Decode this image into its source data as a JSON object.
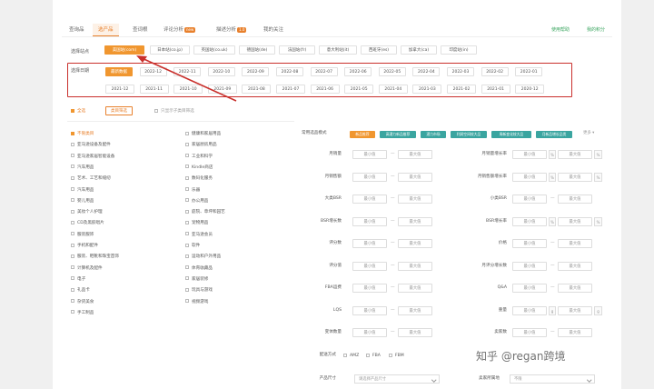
{
  "tabs": [
    {
      "label": "查询品"
    },
    {
      "label": "选产品",
      "active": true
    },
    {
      "label": "查词根"
    },
    {
      "label": "评论分析",
      "badge": "new"
    },
    {
      "label": "描述分析",
      "badge": "1.0"
    },
    {
      "label": "我的关注"
    }
  ],
  "top_links": [
    "使用帮助",
    "我的积分"
  ],
  "site": {
    "label": "选择站点",
    "options": [
      {
        "label": "美国站(com)",
        "active": true
      },
      {
        "label": "日本站(co.jp)"
      },
      {
        "label": "英国站(co.uk)"
      },
      {
        "label": "德国站(de)"
      },
      {
        "label": "法国站(fr)"
      },
      {
        "label": "意大利站(it)"
      },
      {
        "label": "西班牙(es)"
      },
      {
        "label": "加拿大(ca)"
      },
      {
        "label": "印度站(in)"
      }
    ]
  },
  "time": {
    "label": "选择日期",
    "row1": [
      "最新数据",
      "2022-12",
      "2022-11",
      "2022-10",
      "2022-09",
      "2022-08",
      "2022-07",
      "2022-06",
      "2022-05",
      "2022-04",
      "2022-03",
      "2022-02",
      "2022-01"
    ],
    "row2": [
      "2021-12",
      "2021-11",
      "2021-10",
      "2021-09",
      "2021-08",
      "2021-07",
      "2021-06",
      "2021-05",
      "2021-04",
      "2021-03",
      "2021-02",
      "2021-01",
      "2020-12"
    ]
  },
  "category_header": {
    "all": "全选",
    "btn": "类目筛选",
    "check": "只显示子类目筛选"
  },
  "categories_left": [
    "不限类目",
    "亚马逊设备及配件",
    "亚马逊家居智能设备",
    "汽车用品",
    "艺术、工艺和缝纫",
    "汽车用品",
    "婴儿用品",
    "美妆个人护理",
    "CD及黑胶唱片",
    "服装服饰",
    "手机和配件",
    "服装、鞋靴和珠宝首饰",
    "计算机及配件",
    "电子",
    "礼品卡",
    "杂货美食",
    "手工制品"
  ],
  "categories_right": [
    "健康和家居用品",
    "家居厨房用品",
    "工业和科学",
    "Kindle商店",
    "数码化服务",
    "乐器",
    "办公用品",
    "庭院、草坪和园艺",
    "宠物用品",
    "亚马逊会员",
    "软件",
    "运动和户外用品",
    "体育收藏品",
    "家居装修",
    "玩具与游戏",
    "视频游戏"
  ],
  "quick": {
    "label": "常用选品模式",
    "more": "更多 ▾",
    "tags": [
      {
        "label": "新品推荐",
        "color": "#f0962f"
      },
      {
        "label": "高潜力新品推荐",
        "color": "#3aa5a0"
      },
      {
        "label": "潜力市场",
        "color": "#3aa5a0"
      },
      {
        "label": "利润空间较大品",
        "color": "#3aa5a0"
      },
      {
        "label": "周新变化较大品",
        "color": "#3aa5a0"
      },
      {
        "label": "月新品增长品类",
        "color": "#3aa5a0"
      }
    ]
  },
  "filters_left": [
    {
      "label": "月销量",
      "min": "最小值",
      "max": "最大值"
    },
    {
      "label": "月销售额",
      "min": "最小值",
      "max": "最大值"
    },
    {
      "label": "大类BSR",
      "min": "最小值",
      "max": "最大值"
    },
    {
      "label": "BSR增长数",
      "min": "最小值",
      "max": "最大值"
    },
    {
      "label": "评分数",
      "min": "最小值",
      "max": "最大值"
    },
    {
      "label": "评分值",
      "min": "最小值",
      "max": "最大值"
    },
    {
      "label": "FBA运费",
      "min": "最小值",
      "max": "最大值"
    },
    {
      "label": "LQS",
      "min": "最小值",
      "max": "最大值"
    },
    {
      "label": "变体数量",
      "min": "最小值",
      "max": "最大值"
    }
  ],
  "filters_right": [
    {
      "label": "月销量增长率",
      "min": "最小值",
      "max": "最大值",
      "unit": "%"
    },
    {
      "label": "月销售额增长率",
      "min": "最小值",
      "max": "最大值",
      "unit": "%"
    },
    {
      "label": "小类BSR",
      "min": "最小值",
      "max": "最大值"
    },
    {
      "label": "BSR增长率",
      "min": "最小值",
      "max": "最大值",
      "unit": "%"
    },
    {
      "label": "价格",
      "min": "最小值",
      "max": "最大值"
    },
    {
      "label": "月评分增长数",
      "min": "最小值",
      "max": "最大值"
    },
    {
      "label": "Q&A",
      "min": "最小值",
      "max": "最大值"
    },
    {
      "label": "重量",
      "min": "最小值",
      "max": "最大值",
      "unit": "g"
    },
    {
      "label": "卖家数",
      "min": "最小值",
      "max": "最大值"
    }
  ],
  "delivery": {
    "label": "配送方式",
    "options": [
      "AMZ",
      "FBA",
      "FBM"
    ]
  },
  "size": {
    "label": "产品尺寸",
    "placeholder": "请选择产品尺寸"
  },
  "seller": {
    "label": "卖家所属地",
    "placeholder": "不限"
  },
  "watermark": {
    "site": "知乎",
    "author": "@regan跨境"
  }
}
